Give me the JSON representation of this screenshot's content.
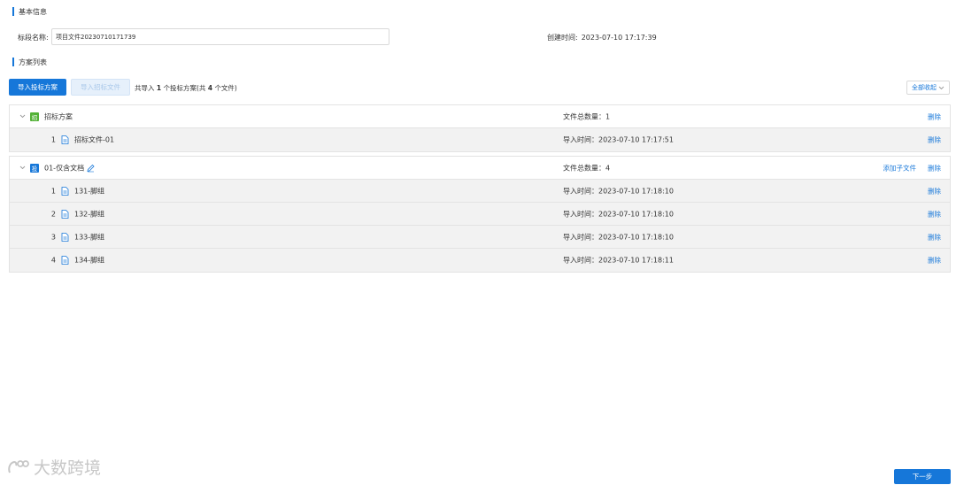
{
  "basic_info": {
    "section_title": "基本信息",
    "field_label": "标段名称:",
    "field_value": "项目文件20230710171739",
    "created_label": "创建时间:",
    "created_value": "2023-07-10 17:17:39"
  },
  "plan_list": {
    "section_title": "方案列表",
    "import_plan_btn": "导入投标方案",
    "import_file_btn": "导入招标文件",
    "import_info_prefix": "共导入",
    "import_count": "1",
    "import_info_mid": "个投标方案(共",
    "file_count": "4",
    "import_info_suffix": "个文件)",
    "collapse_all": "全部收起"
  },
  "groups": [
    {
      "tag": "招",
      "tag_color": "#52b135",
      "name": "招标方案",
      "count_text": "文件总数量：1",
      "delete": "删除",
      "add_sub": "",
      "files": [
        {
          "index": "1",
          "name": "招标文件-01",
          "time": "导入时间：2023-07-10 17:17:51",
          "delete": "删除"
        }
      ]
    },
    {
      "tag": "投",
      "tag_color": "#1677d9",
      "name": "01-仅含文档",
      "count_text": "文件总数量：4",
      "delete": "删除",
      "add_sub": "添加子文件",
      "files": [
        {
          "index": "1",
          "name": "131-脚组",
          "time": "导入时间：2023-07-10 17:18:10",
          "delete": "删除"
        },
        {
          "index": "2",
          "name": "132-脚组",
          "time": "导入时间：2023-07-10 17:18:10",
          "delete": "删除"
        },
        {
          "index": "3",
          "name": "133-脚组",
          "time": "导入时间：2023-07-10 17:18:10",
          "delete": "删除"
        },
        {
          "index": "4",
          "name": "134-脚组",
          "time": "导入时间：2023-07-10 17:18:11",
          "delete": "删除"
        }
      ]
    }
  ],
  "footer": {
    "watermark": "大数跨境",
    "next_btn": "下一步"
  },
  "icons": {
    "chevron": "chevron-down-icon",
    "file": "file-icon",
    "edit": "edit-icon"
  }
}
